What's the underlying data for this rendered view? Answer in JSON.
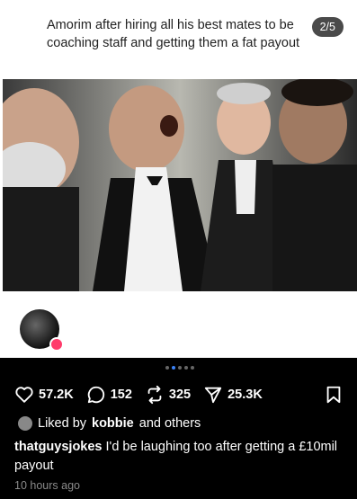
{
  "post": {
    "caption": "Amorim after hiring all his best mates to be coaching staff and getting them a fat payout",
    "pager": "2/5"
  },
  "actions": {
    "likes": "57.2K",
    "comments": "152",
    "reposts": "325",
    "shares": "25.3K"
  },
  "liked_by": {
    "prefix": "Liked by",
    "user": "kobbie",
    "suffix": "and others"
  },
  "comment": {
    "user": "thatguysjokes",
    "text": "I'd be laughing too after getting a £10mil payout"
  },
  "timestamp": "10 hours ago",
  "icons": {
    "heart": "heart-icon",
    "comment": "comment-icon",
    "repost": "repost-icon",
    "share": "share-icon",
    "bookmark": "bookmark-icon"
  }
}
